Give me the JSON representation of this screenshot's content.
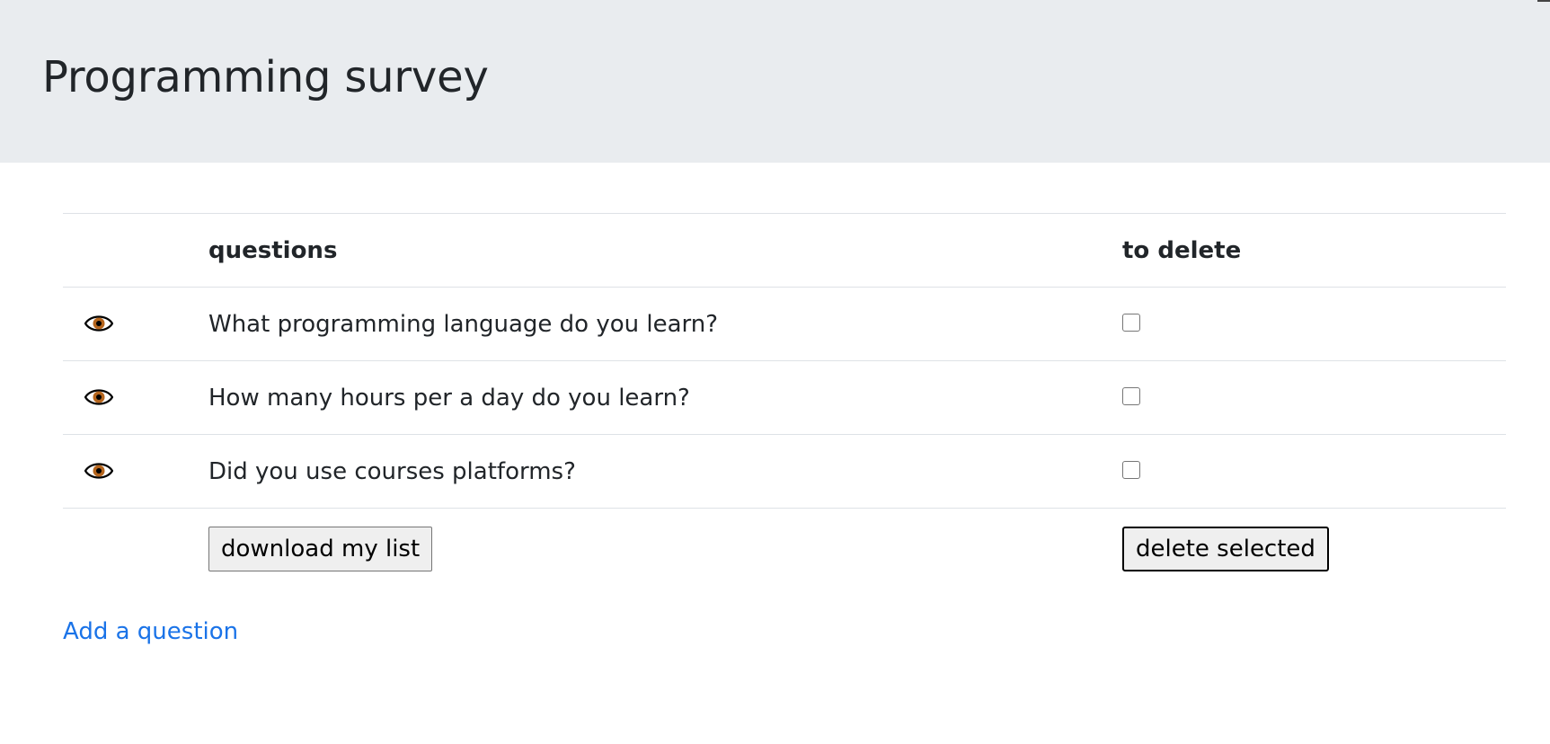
{
  "page": {
    "title": "Programming survey"
  },
  "table": {
    "headers": {
      "questions": "questions",
      "to_delete": "to delete"
    },
    "rows": [
      {
        "icon": "eye-icon",
        "question": "What programming language do you learn?",
        "checked": false
      },
      {
        "icon": "eye-icon",
        "question": "How many hours per a day do you learn?",
        "checked": false
      },
      {
        "icon": "eye-icon",
        "question": "Did you use courses platforms?",
        "checked": false
      }
    ]
  },
  "actions": {
    "download_label": "download my list",
    "delete_label": "delete selected"
  },
  "links": {
    "add_question": "Add a question"
  },
  "colors": {
    "header_bg": "#e9ecef",
    "link": "#1a73e8",
    "text": "#212529",
    "eye_iris": "#b5651d"
  }
}
